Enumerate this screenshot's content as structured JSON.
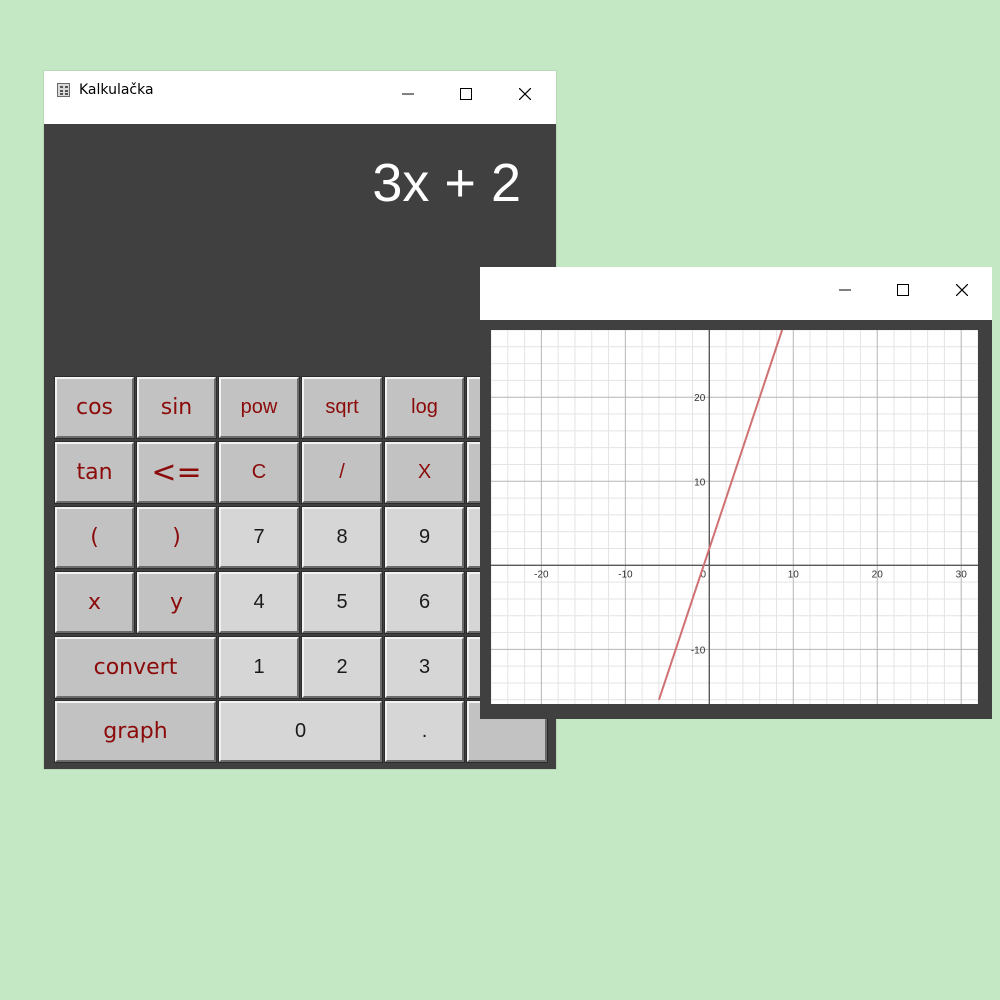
{
  "calculator": {
    "title": "Kalkulačka",
    "display": "3x + 2",
    "keys": [
      "cos",
      "sin",
      "pow",
      "sqrt",
      "log",
      "tan",
      "<=",
      "C",
      "/",
      "X",
      "(",
      ")",
      "7",
      "8",
      "9",
      "x",
      "y",
      "4",
      "5",
      "6",
      "convert",
      "1",
      "2",
      "3",
      "graph",
      "0",
      "."
    ]
  },
  "graph_window": {
    "title": ""
  },
  "chart_data": {
    "type": "line",
    "title": "",
    "xlabel": "",
    "ylabel": "",
    "xlim": [
      -26,
      32
    ],
    "ylim": [
      -16.5,
      28
    ],
    "grid": true,
    "x_ticks": [
      "-20",
      "-10",
      "0",
      "10",
      "20",
      "30"
    ],
    "y_ticks": [
      "-10",
      "10",
      "20"
    ],
    "series": [
      {
        "x": [
          -6,
          0,
          8.67
        ],
        "y": [
          -16,
          2,
          28
        ],
        "color": "#d07070"
      }
    ]
  },
  "colors": {
    "background": "#c4e7c4",
    "window_dark": "#404040",
    "key_text_function": "#8b0a0a",
    "line": "#d07070"
  }
}
